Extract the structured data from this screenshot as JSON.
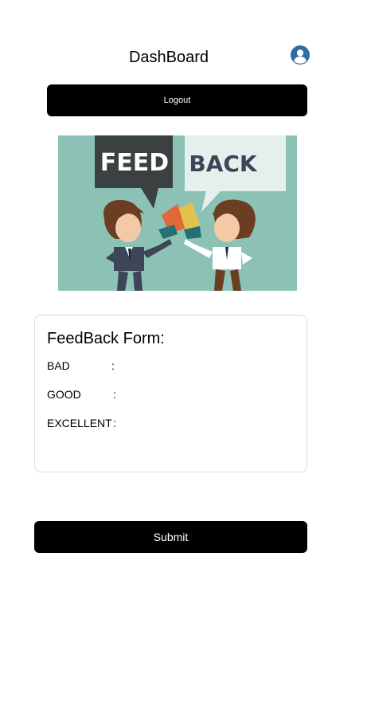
{
  "header": {
    "title": "DashBoard",
    "avatar_icon": "user-avatar-icon",
    "avatar_color": "#2e6da4"
  },
  "logout": {
    "label": "Logout"
  },
  "banner": {
    "left_bubble_text": "FEED",
    "right_bubble_text": "BACK",
    "background_color": "#8cc2b6"
  },
  "form": {
    "title": "FeedBack Form:",
    "rows": [
      {
        "label": "BAD",
        "separator": ":"
      },
      {
        "label": "GOOD",
        "separator": ":"
      },
      {
        "label": "EXCELLENT",
        "separator": ":"
      }
    ]
  },
  "submit": {
    "label": "Submit"
  }
}
